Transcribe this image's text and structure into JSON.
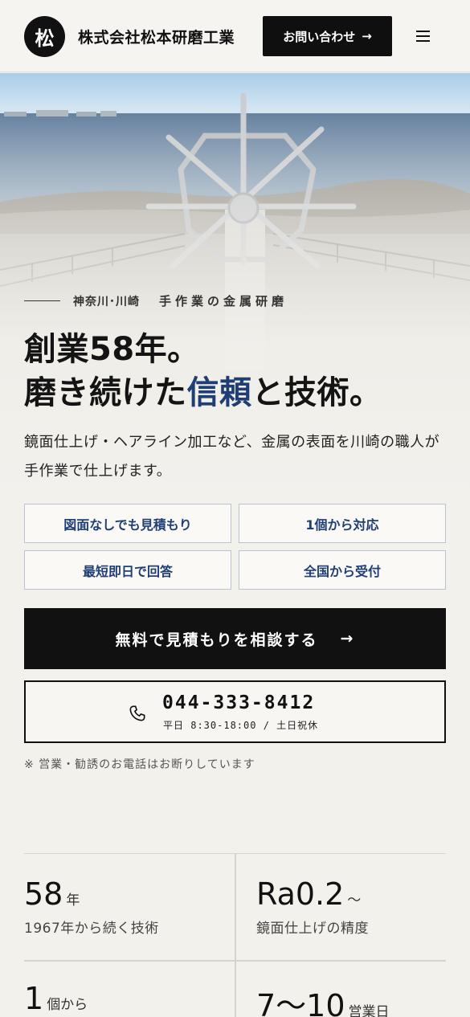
{
  "header": {
    "logo_char": "松",
    "company_name": "株式会社松本研磨工業",
    "contact_label": "お問い合わせ",
    "contact_arrow": "→"
  },
  "hero": {
    "tagline_area": "神奈川･川崎",
    "tagline_craft": "手作業の金属研磨",
    "headline_line1": "創業58年。",
    "headline_line2_pre": "磨き続けた",
    "headline_line2_accent": "信頼",
    "headline_line2_post": "と技術。",
    "lead": "鏡面仕上げ・ヘアライン加工など、金属の表面を川崎の職人が手作業で仕上げます。",
    "features": [
      "図面なしでも見積もり",
      "1個から対応",
      "最短即日で回答",
      "全国から受付"
    ],
    "cta_label": "無料で見積もりを相談する",
    "cta_arrow": "→",
    "phone_number": "044-333-8412",
    "phone_hours": "平日 8:30-18:00 / 土日祝休",
    "note": "※ 営業・勧誘のお電話はお断りしています"
  },
  "stats": [
    {
      "value": "58",
      "unit": "年",
      "desc": "1967年から続く技術"
    },
    {
      "value": "Ra0.2",
      "unit": "〜",
      "desc": "鏡面仕上げの精度"
    },
    {
      "value": "1",
      "unit": "個から",
      "desc": ""
    },
    {
      "value": "7〜10",
      "unit": "営業日",
      "desc": ""
    }
  ],
  "colors": {
    "accent": "#1f3e73",
    "dark": "#111112",
    "background": "#f3f1ec"
  }
}
